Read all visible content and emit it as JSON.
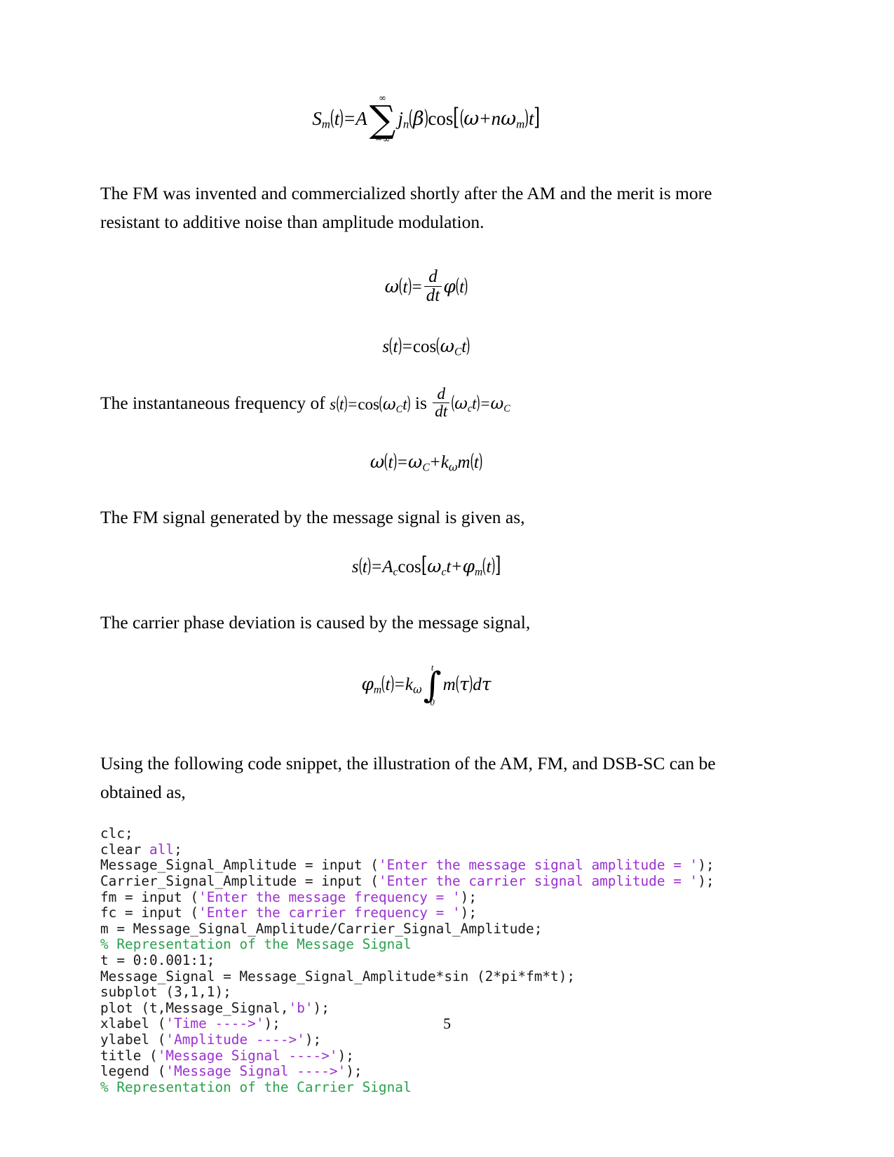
{
  "document": {
    "page_number": "5"
  },
  "equations": {
    "fm_series": {
      "lhs_S": "S",
      "lhs_sub": "m",
      "t": "t",
      "eq": "=",
      "A": "A",
      "sum_upper": "∞",
      "sum_lower": "−∞",
      "sum_glyph": "∑",
      "j": "j",
      "j_sub": "n",
      "beta": "β",
      "cos": "cos",
      "omega": "ω",
      "plus": "+",
      "n": "n",
      "omega_m_sub": "m"
    },
    "omega_derivative": {
      "omega": "ω",
      "t": "t",
      "eq": "=",
      "d": "d",
      "dt": "dt",
      "phi": "φ"
    },
    "s_cos": {
      "s": "s",
      "t": "t",
      "eq": "=",
      "cos": "cos",
      "omega": "ω",
      "omega_sub": "C"
    },
    "instantaneous_line": {
      "text_before": "The instantaneous frequency of ",
      "text_middle": " is ",
      "s": "s",
      "t": "t",
      "eq": "=",
      "cos": "cos",
      "omega": "ω",
      "omega_sub_cap": "C",
      "d": "d",
      "dt": "dt",
      "omega_sub_low": "c",
      "result_omega": "ω",
      "result_sub": "C"
    },
    "omega_instant": {
      "omega": "ω",
      "t": "t",
      "eq": "=",
      "omega_c_sub": "C",
      "plus": "+",
      "k": "k",
      "k_sub": "ω",
      "m": "m"
    },
    "fm_signal": {
      "s": "s",
      "t": "t",
      "eq": "=",
      "A": "A",
      "A_sub": "c",
      "cos": "cos",
      "omega": "ω",
      "omega_sub": "c",
      "plus": "+",
      "phi": "φ",
      "phi_sub": "m"
    },
    "phase_deviation": {
      "phi": "φ",
      "phi_sub": "m",
      "t": "t",
      "eq": "=",
      "k": "k",
      "k_sub": "ω",
      "int_glyph": "∫",
      "int_upper": "t",
      "int_lower": "0",
      "m": "m",
      "tau": "τ",
      "d": "d",
      "dtau": "τ"
    }
  },
  "paragraphs": {
    "p1": "The FM was invented and commercialized shortly after the AM and the merit is more resistant to additive noise than amplitude modulation.",
    "p2": "The FM signal generated by the message signal is given as,",
    "p3": "The carrier phase deviation is caused by the message signal,",
    "p4": "Using the following code snippet, the illustration of the AM, FM, and DSB-SC can be obtained as,"
  },
  "code_block": {
    "language": "matlab",
    "lines": [
      [
        {
          "t": "clc;",
          "c": "plain"
        }
      ],
      [
        {
          "t": "clear ",
          "c": "plain"
        },
        {
          "t": "all",
          "c": "keyword"
        },
        {
          "t": ";",
          "c": "plain"
        }
      ],
      [
        {
          "t": "Message_Signal_Amplitude = input (",
          "c": "plain"
        },
        {
          "t": "'Enter the message signal amplitude = '",
          "c": "string"
        },
        {
          "t": ");",
          "c": "plain"
        }
      ],
      [
        {
          "t": "Carrier_Signal_Amplitude = input (",
          "c": "plain"
        },
        {
          "t": "'Enter the carrier signal amplitude = '",
          "c": "string"
        },
        {
          "t": ");",
          "c": "plain"
        }
      ],
      [
        {
          "t": "fm = input (",
          "c": "plain"
        },
        {
          "t": "'Enter the message frequency = '",
          "c": "string"
        },
        {
          "t": ");",
          "c": "plain"
        }
      ],
      [
        {
          "t": "fc = input (",
          "c": "plain"
        },
        {
          "t": "'Enter the carrier frequency = '",
          "c": "string"
        },
        {
          "t": ");",
          "c": "plain"
        }
      ],
      [
        {
          "t": "m = Message_Signal_Amplitude/Carrier_Signal_Amplitude;",
          "c": "plain"
        }
      ],
      [
        {
          "t": "% Representation of the Message Signal",
          "c": "comment"
        }
      ],
      [
        {
          "t": "t = 0:0.001:1;",
          "c": "plain"
        }
      ],
      [
        {
          "t": "Message_Signal = Message_Signal_Amplitude*sin (2*pi*fm*t);",
          "c": "plain"
        }
      ],
      [
        {
          "t": "subplot (3,1,1);",
          "c": "plain"
        }
      ],
      [
        {
          "t": "plot (t,Message_Signal,",
          "c": "plain"
        },
        {
          "t": "'b'",
          "c": "string"
        },
        {
          "t": ");",
          "c": "plain"
        }
      ],
      [
        {
          "t": "xlabel (",
          "c": "plain"
        },
        {
          "t": "'Time ---->'",
          "c": "string"
        },
        {
          "t": ");",
          "c": "plain"
        }
      ],
      [
        {
          "t": "ylabel (",
          "c": "plain"
        },
        {
          "t": "'Amplitude ---->'",
          "c": "string"
        },
        {
          "t": ");",
          "c": "plain"
        }
      ],
      [
        {
          "t": "title (",
          "c": "plain"
        },
        {
          "t": "'Message Signal ---->'",
          "c": "string"
        },
        {
          "t": ");",
          "c": "plain"
        }
      ],
      [
        {
          "t": "legend (",
          "c": "plain"
        },
        {
          "t": "'Message Signal ---->'",
          "c": "string"
        },
        {
          "t": ");",
          "c": "plain"
        }
      ],
      [
        {
          "t": "% Representation of the Carrier Signal",
          "c": "comment"
        }
      ]
    ]
  },
  "colors": {
    "string": "#9b30d0",
    "comment": "#2ba14f",
    "text": "#000000",
    "background": "#ffffff"
  }
}
